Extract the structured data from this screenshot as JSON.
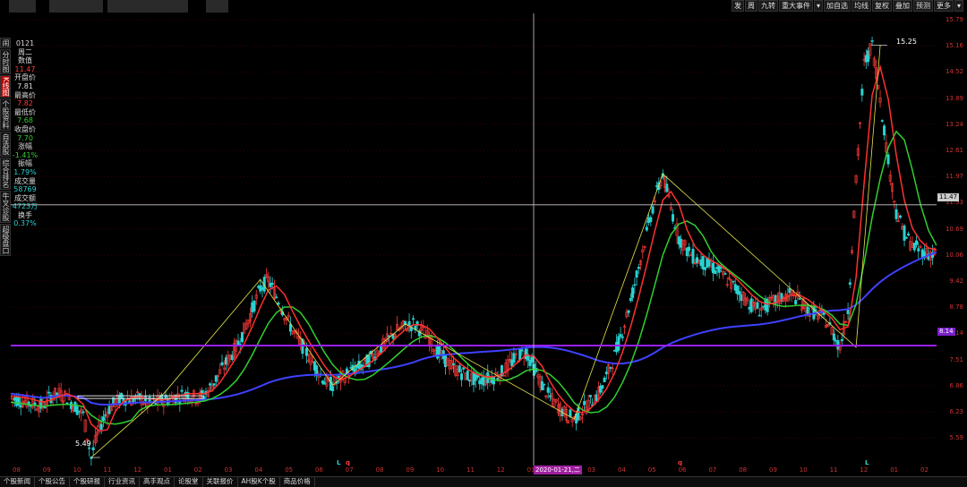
{
  "toolbar": {
    "buttons": [
      "发",
      "周",
      "九转",
      "重大事件",
      "▾",
      "加自选",
      "均线",
      "复权",
      "叠加",
      "预测",
      "更多",
      "▾"
    ]
  },
  "leftnav": {
    "items": [
      {
        "label": "闹",
        "active": false
      },
      {
        "label": "分时图",
        "active": false
      },
      {
        "label": "K线图",
        "active": true
      },
      {
        "label": "个股资料",
        "active": false
      },
      {
        "label": "自选股",
        "active": false
      },
      {
        "label": "综合排名",
        "active": false
      },
      {
        "label": "牛叉诊股",
        "active": false
      },
      {
        "label": "超级盘口",
        "active": false
      }
    ]
  },
  "info": {
    "date": "0121",
    "weekday": "周二",
    "value_label": "数值",
    "value": "11.47",
    "open_label": "开盘价",
    "open": "7.81",
    "high_label": "最高价",
    "high": "7.82",
    "low_label": "最低价",
    "low": "7.68",
    "close_label": "收盘价",
    "close": "7.70",
    "change_label": "涨幅",
    "change": "-1.41%",
    "amplitude_label": "振幅",
    "amplitude": "1.79%",
    "volume_label": "成交量",
    "volume": "58769",
    "amount_label": "成交额",
    "amount": "4723万",
    "turnover_label": "换手",
    "turnover": "0.37%"
  },
  "yaxis": {
    "ticks": [
      "15.79",
      "15.16",
      "14.52",
      "13.89",
      "13.24",
      "12.61",
      "11.97",
      "11.33",
      "10.69",
      "10.06",
      "9.42",
      "8.78",
      "8.14",
      "7.51",
      "6.86",
      "6.23",
      "5.59"
    ],
    "cursor_tag": "11.47",
    "support_tag": "8.14"
  },
  "xaxis": {
    "ticks": [
      "08",
      "09",
      "10",
      "11",
      "12",
      "01",
      "02",
      "03",
      "04",
      "05",
      "06",
      "07",
      "08",
      "09",
      "10",
      "11",
      "12",
      "01",
      "02",
      "03",
      "04",
      "05",
      "06",
      "07",
      "08",
      "09",
      "10",
      "11",
      "12",
      "01",
      "02"
    ],
    "cursor_date": "2020-01-21,二"
  },
  "annotations": {
    "low": "5.49",
    "high": "15.25"
  },
  "markers": [
    "L",
    "q",
    "q",
    "L"
  ],
  "bottom_tabs": [
    "个股新闻",
    "个股公告",
    "个股研报",
    "行业资讯",
    "高手观点",
    "论股堂",
    "关联报价",
    "AH股K个股",
    "商品价格"
  ],
  "colors": {
    "up": "#ff3b3b",
    "down": "#2bd2d2",
    "ma_red": "#ff3030",
    "ma_green": "#30d030",
    "ma_blue": "#4040ff",
    "support": "#9a20ff",
    "zigzag": "#e6e64d"
  },
  "chart_data": {
    "type": "candlestick",
    "ylim": [
      5.3,
      16.0
    ],
    "series": [
      {
        "name": "price",
        "values": [
          6.9,
          6.85,
          6.8,
          6.75,
          6.7,
          6.95,
          7.0,
          6.9,
          6.7,
          6.5,
          5.49,
          6.2,
          6.6,
          6.8,
          6.9,
          6.85,
          6.9,
          6.75,
          6.8,
          6.85,
          6.9,
          6.95,
          7.0,
          6.9,
          6.95,
          7.2,
          7.5,
          7.8,
          8.1,
          8.5,
          9.0,
          9.5,
          9.7,
          9.3,
          8.9,
          8.5,
          8.2,
          7.9,
          7.6,
          7.3,
          7.2,
          7.35,
          7.5,
          7.6,
          7.7,
          7.9,
          8.1,
          8.3,
          8.5,
          8.6,
          8.65,
          8.5,
          8.3,
          8.0,
          7.8,
          7.6,
          7.5,
          7.4,
          7.3,
          7.35,
          7.4,
          7.5,
          7.7,
          7.9,
          8.0,
          7.6,
          7.2,
          6.9,
          6.7,
          6.5,
          6.4,
          6.6,
          6.8,
          7.0,
          7.4,
          7.9,
          8.5,
          9.2,
          10.0,
          10.8,
          11.6,
          12.2,
          11.4,
          10.7,
          10.4,
          10.2,
          10.1,
          10.0,
          9.9,
          9.7,
          9.5,
          9.3,
          9.1,
          9.0,
          9.1,
          9.2,
          9.3,
          9.35,
          9.2,
          9.0,
          8.9,
          8.8,
          8.5,
          8.1,
          9.0,
          12.0,
          14.8,
          15.25,
          14.0,
          12.5,
          11.3,
          10.8,
          10.5,
          10.4,
          10.3,
          10.35
        ]
      }
    ]
  }
}
